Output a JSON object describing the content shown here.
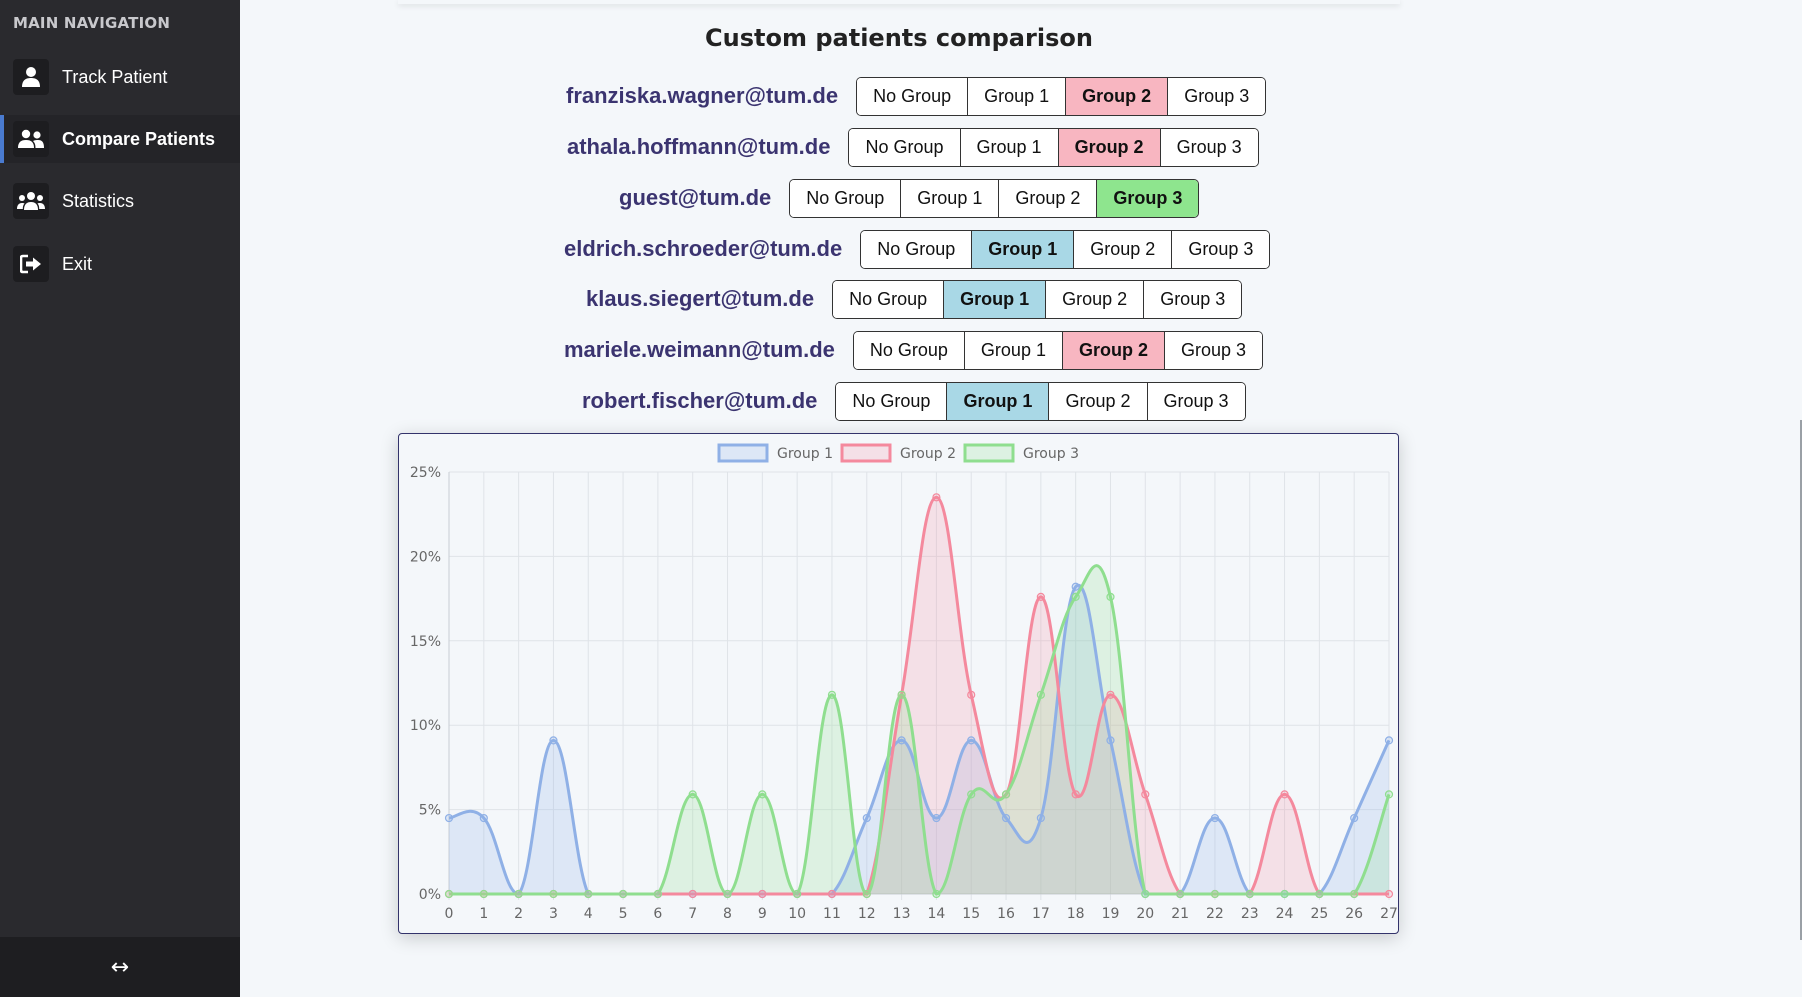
{
  "sidebar": {
    "header": "MAIN NAVIGATION",
    "items": [
      {
        "label": "Track Patient",
        "icon": "user-icon"
      },
      {
        "label": "Compare Patients",
        "icon": "users-icon",
        "active": true
      },
      {
        "label": "Statistics",
        "icon": "group-icon"
      },
      {
        "label": "Exit",
        "icon": "exit-icon"
      }
    ],
    "footer_toggle": "↔"
  },
  "page": {
    "title": "Custom patients comparison"
  },
  "group_options": [
    "No Group",
    "Group 1",
    "Group 2",
    "Group 3"
  ],
  "patients": [
    {
      "email": "franziska.wagner@tum.de",
      "selected": "Group 2"
    },
    {
      "email": "athala.hoffmann@tum.de",
      "selected": "Group 2"
    },
    {
      "email": "guest@tum.de",
      "selected": "Group 3"
    },
    {
      "email": "eldrich.schroeder@tum.de",
      "selected": "Group 1"
    },
    {
      "email": "klaus.siegert@tum.de",
      "selected": "Group 1"
    },
    {
      "email": "mariele.weimann@tum.de",
      "selected": "Group 2"
    },
    {
      "email": "robert.fischer@tum.de",
      "selected": "Group 1"
    }
  ],
  "colors": {
    "sidebar_bg": "#2a2a2e",
    "active_accent": "#4a7bd0",
    "email_text": "#3b3470",
    "group1_selected": "#a9d8e6",
    "group2_selected": "#f8b6c1",
    "group3_selected": "#8ee58e"
  },
  "chart_data": {
    "type": "line",
    "smooth": true,
    "filled": true,
    "legend_position": "top-center",
    "grid": true,
    "x": [
      0,
      1,
      2,
      3,
      4,
      5,
      6,
      7,
      8,
      9,
      10,
      11,
      12,
      13,
      14,
      15,
      16,
      17,
      18,
      19,
      20,
      21,
      22,
      23,
      24,
      25,
      26,
      27
    ],
    "ylim": [
      0,
      25
    ],
    "yticks": [
      0,
      5,
      10,
      15,
      20,
      25
    ],
    "ytick_labels": [
      "0%",
      "5%",
      "10%",
      "15%",
      "20%",
      "25%"
    ],
    "series": [
      {
        "name": "Group 1",
        "color": "#8fb0e6",
        "fill": "rgba(143,176,230,0.22)",
        "values": [
          4.5,
          4.5,
          0,
          9.1,
          0,
          0,
          0,
          0,
          0,
          0,
          0,
          0,
          4.5,
          9.1,
          4.5,
          9.1,
          4.5,
          4.5,
          18.2,
          9.1,
          0,
          0,
          4.5,
          0,
          0,
          0,
          4.5,
          9.1
        ]
      },
      {
        "name": "Group 2",
        "color": "#f4899d",
        "fill": "rgba(244,137,157,0.20)",
        "values": [
          0,
          0,
          0,
          0,
          0,
          0,
          0,
          0,
          0,
          0,
          0,
          0,
          0,
          11.8,
          23.5,
          11.8,
          5.9,
          17.6,
          5.9,
          11.8,
          5.9,
          0,
          0,
          0,
          5.9,
          0,
          0,
          0
        ]
      },
      {
        "name": "Group 3",
        "color": "#8fde8f",
        "fill": "rgba(143,222,143,0.22)",
        "values": [
          0,
          0,
          0,
          0,
          0,
          0,
          0,
          5.9,
          0,
          5.9,
          0,
          11.8,
          0,
          11.8,
          0,
          5.9,
          5.9,
          11.8,
          17.6,
          17.6,
          0,
          0,
          0,
          0,
          0,
          0,
          0,
          5.9
        ]
      }
    ]
  }
}
